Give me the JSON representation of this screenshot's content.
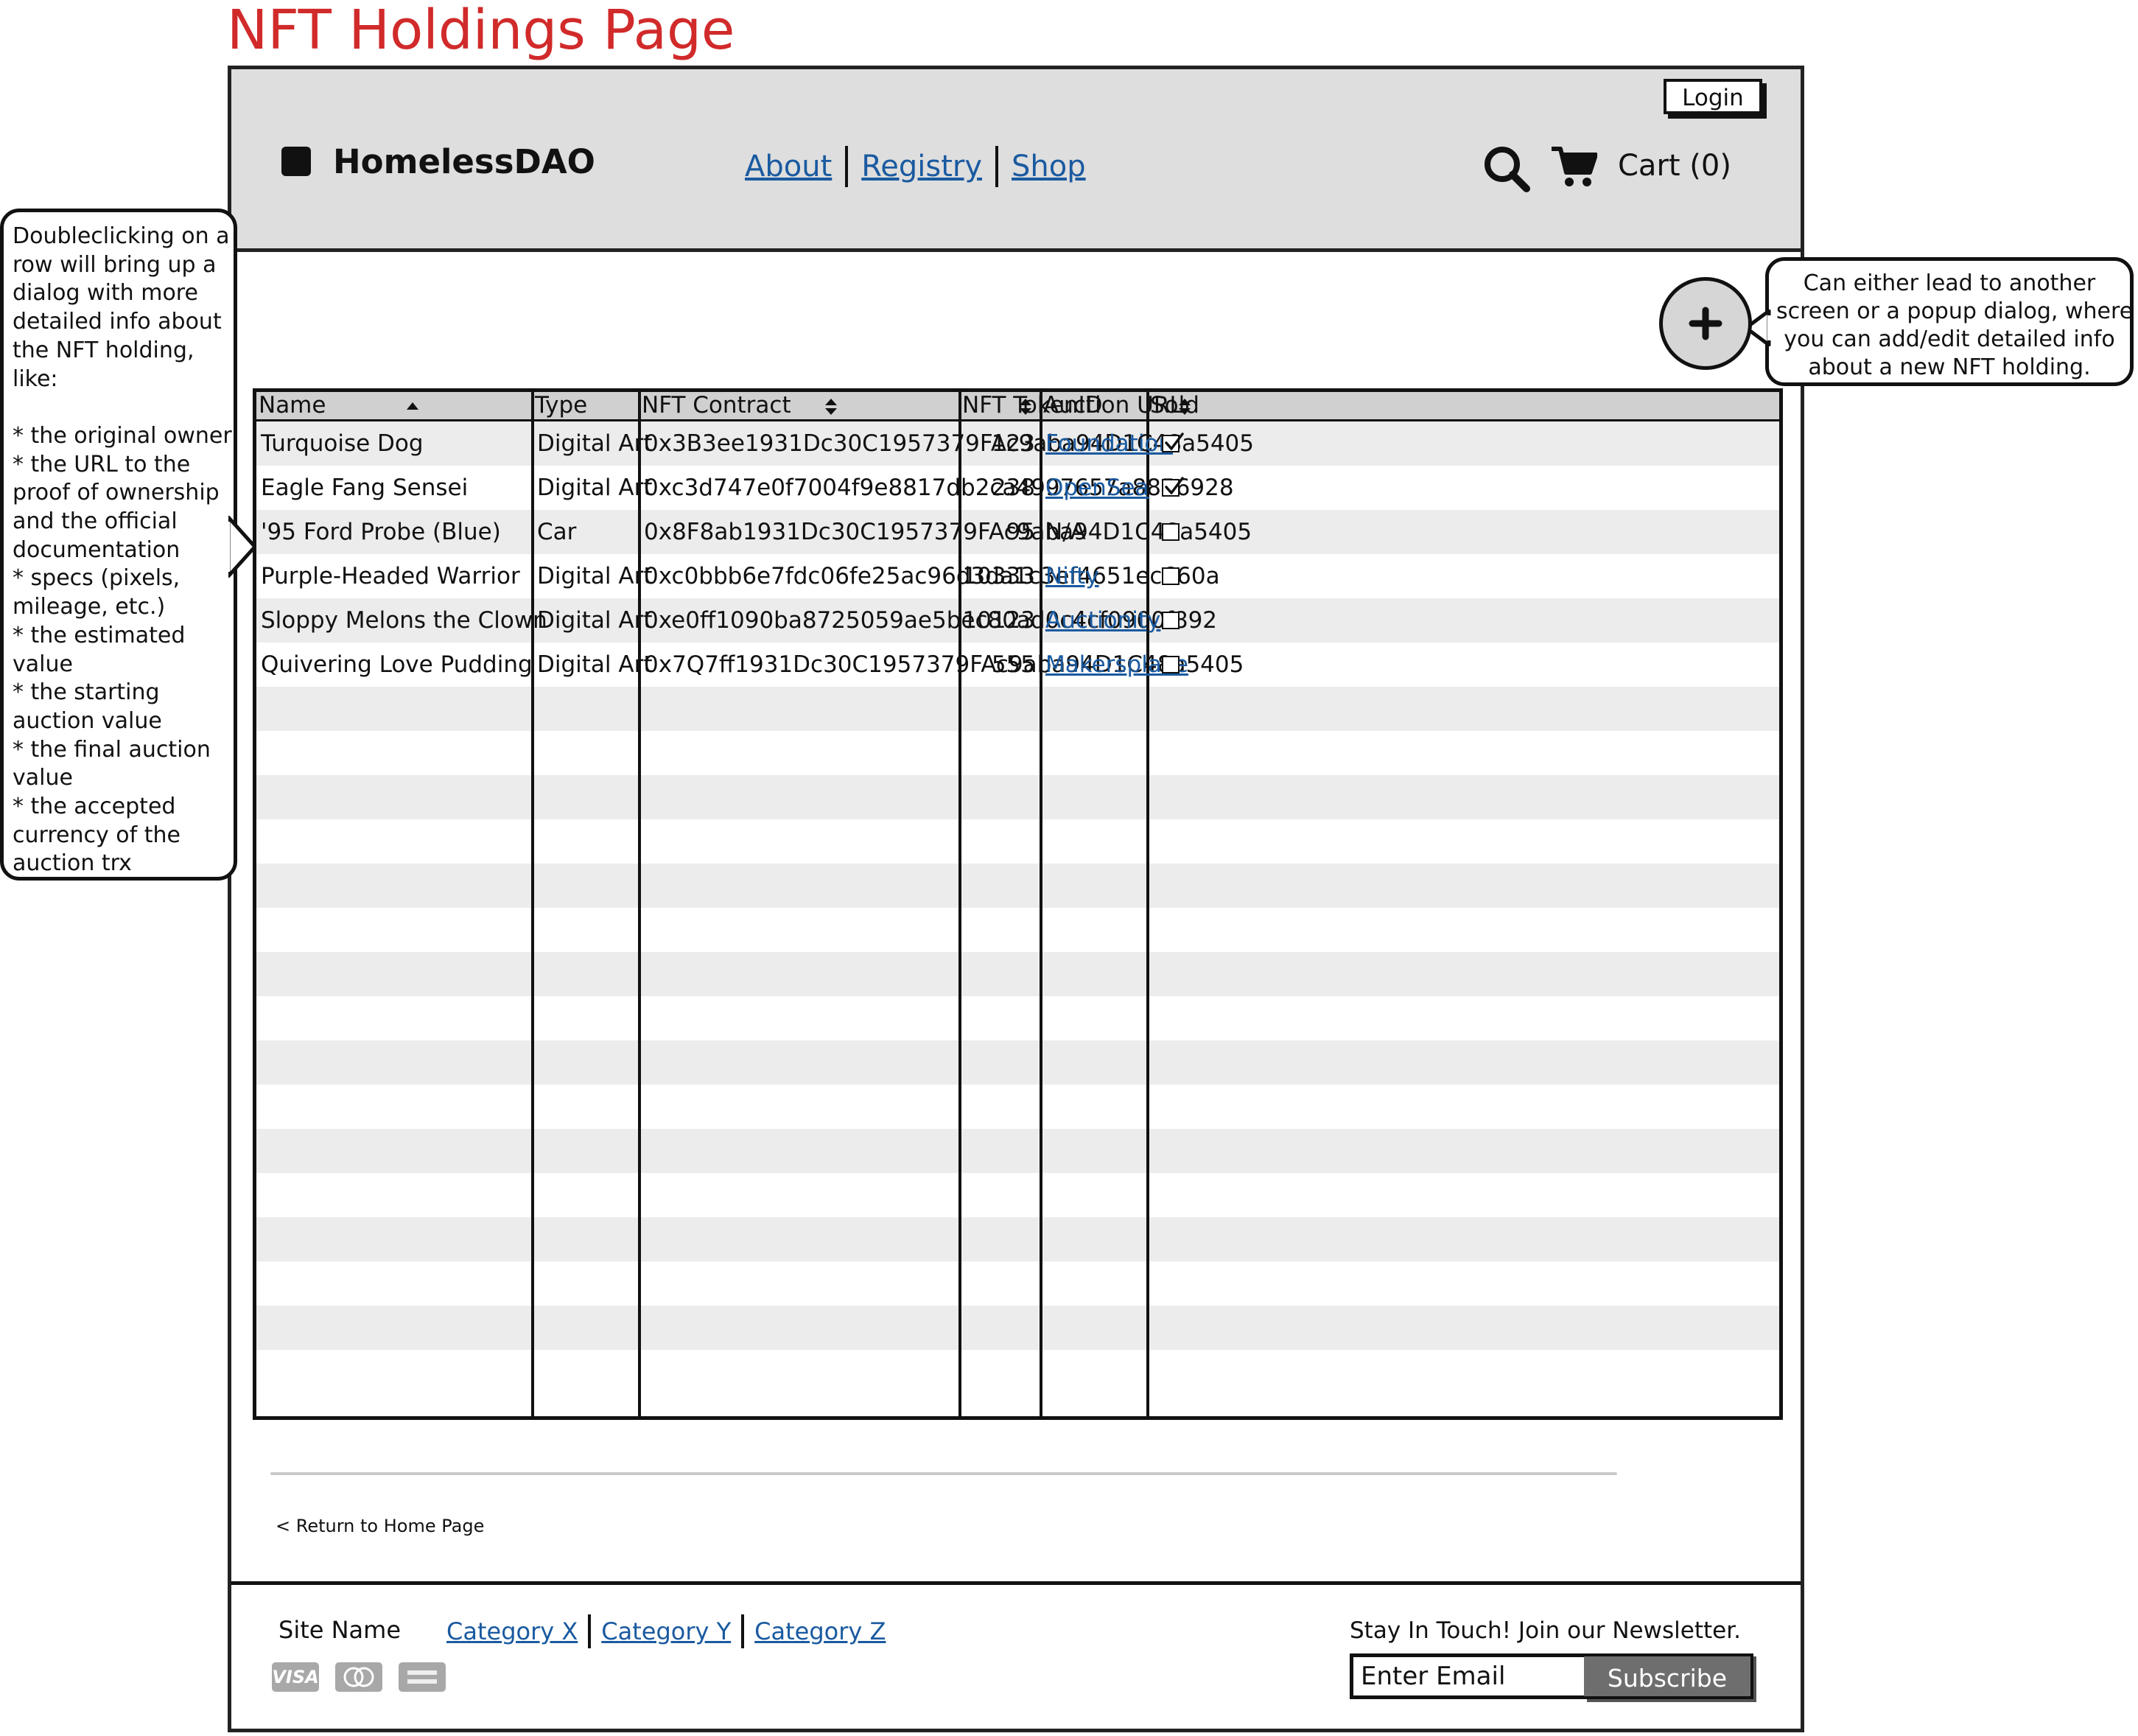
{
  "page_title": "NFT Holdings Page",
  "header": {
    "login_label": "Login",
    "brand": "HomelessDAO",
    "nav": [
      "About",
      "Registry",
      "Shop"
    ],
    "cart_label": "Cart (0)"
  },
  "callouts": {
    "row_dialog": [
      "Doubleclicking on a",
      "row will bring up a",
      "dialog with more",
      "detailed info about",
      "the NFT holding,",
      "like:",
      "",
      "* the original owner",
      "* the URL to the",
      "proof of ownership",
      "and the official",
      "documentation",
      "* specs (pixels,",
      "mileage, etc.)",
      "* the estimated",
      "value",
      "* the starting",
      "auction value",
      "* the final auction",
      "value",
      "* the accepted",
      "currency of the",
      "auction trx"
    ],
    "add_button": [
      "Can either lead to another",
      "screen or a popup dialog, where",
      "you can add/edit detailed info",
      "about a new NFT holding."
    ]
  },
  "table": {
    "columns": [
      "Name",
      "Type",
      "NFT Contract",
      "NFT TokenID",
      "Auction URL",
      "Sold"
    ],
    "rows": [
      {
        "name": "Turquoise Dog",
        "type": "Digital Art",
        "contract": "0x3B3ee1931Dc30C1957379FAc9aba94D1C48a5405",
        "token_id": "123",
        "auction_url": "Foundation",
        "sold": true
      },
      {
        "name": "Eagle Fang Sensei",
        "type": "Digital Art",
        "contract": "0xc3d747e0f7004f9e8817db2ca4997657a8856928",
        "token_id": "238",
        "auction_url": "OpenSea",
        "sold": true
      },
      {
        "name": "'95 Ford Probe (Blue)",
        "type": "Car",
        "contract": "0x8F8ab1931Dc30C1957379FAc9aba94D1C48a5405",
        "token_id": "95",
        "auction_url": "N/A",
        "sold": false
      },
      {
        "name": "Purple-Headed Warrior",
        "type": "Digital Art",
        "contract": "0xc0bbb6e7fdc06fe25ac96d3da1c3ef4651ec660a",
        "token_id": "10333",
        "auction_url": "Nifty",
        "sold": false
      },
      {
        "name": "Sloppy Melons the Clown",
        "type": "Digital Art",
        "contract": "0xe0ff1090ba8725059ae5bec80ad0c4cf0900f892",
        "token_id": "10123",
        "auction_url": "Auctionity",
        "sold": false
      },
      {
        "name": "Quivering Love Pudding",
        "type": "Digital Art",
        "contract": "0x7Q7ff1931Dc30C1957379FAc9aba94D1C48a5405",
        "token_id": "555",
        "auction_url": "Makersplace",
        "sold": false
      }
    ]
  },
  "return_link": "< Return to Home Page",
  "footer": {
    "site_name": "Site Name",
    "categories": [
      "Category X",
      "Category Y",
      "Category Z"
    ],
    "payment_icons": [
      "visa-card-icon",
      "mastercard-icon",
      "amex-card-icon"
    ],
    "visa_text": "VISA",
    "newsletter_label": "Stay In Touch! Join our Newsletter.",
    "email_placeholder": "Enter Email",
    "subscribe_label": "Subscribe"
  },
  "colors": {
    "title_red": "#d12a2a",
    "link_blue": "#1a5aa0",
    "header_bg": "#dedede",
    "stripe": "#ececec"
  }
}
